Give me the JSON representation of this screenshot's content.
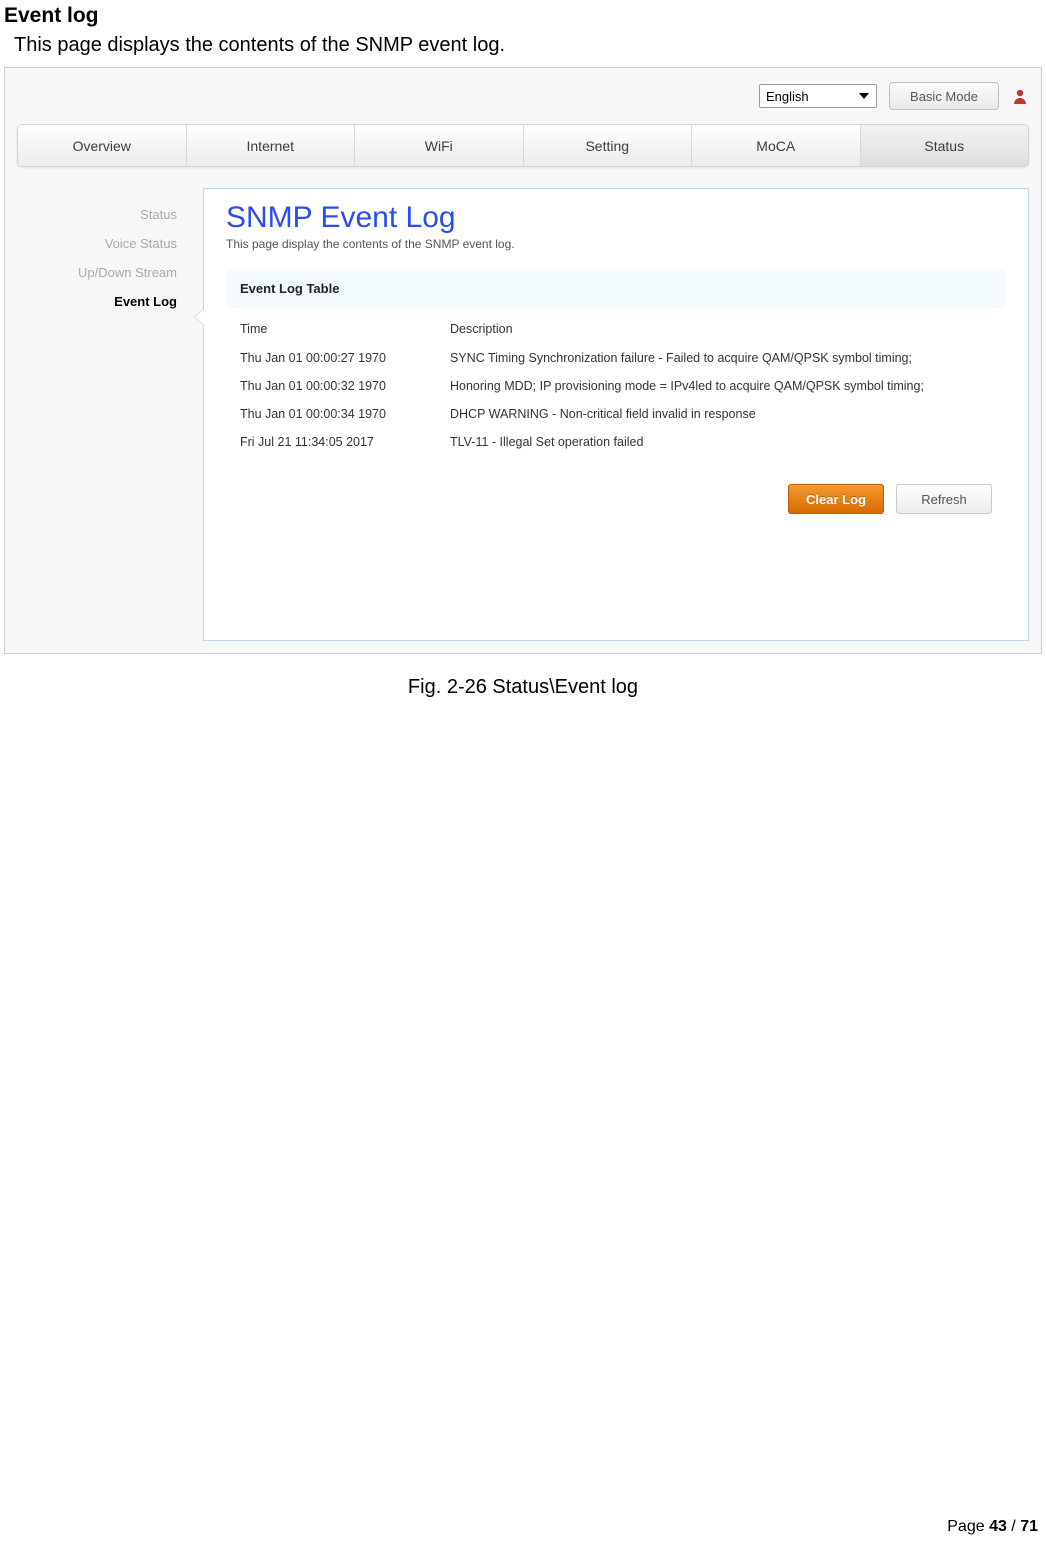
{
  "doc": {
    "heading": "Event log",
    "description": "This page displays the contents of the SNMP event log.",
    "caption": "Fig. 2-26 Status\\Event log",
    "footer_prefix": "Page ",
    "footer_page": "43",
    "footer_sep": " / ",
    "footer_total": "71"
  },
  "top": {
    "language_selected": "English",
    "basic_mode": "Basic Mode"
  },
  "tabs": {
    "items": [
      {
        "label": "Overview"
      },
      {
        "label": "Internet"
      },
      {
        "label": "WiFi"
      },
      {
        "label": "Setting"
      },
      {
        "label": "MoCA"
      },
      {
        "label": "Status"
      }
    ],
    "active_index": 5
  },
  "sidebar": {
    "items": [
      {
        "label": "Status"
      },
      {
        "label": "Voice Status"
      },
      {
        "label": "Up/Down Stream"
      },
      {
        "label": "Event Log"
      }
    ],
    "active_index": 3
  },
  "panel": {
    "title": "SNMP Event Log",
    "subtitle": "This page display the contents of the SNMP event log.",
    "table_header": "Event Log Table",
    "col_time": "Time",
    "col_desc": "Description",
    "rows": [
      {
        "time": "Thu Jan 01 00:00:27 1970",
        "desc": "SYNC Timing Synchronization failure - Failed to acquire QAM/QPSK symbol timing;"
      },
      {
        "time": "Thu Jan 01 00:00:32 1970",
        "desc": "Honoring MDD; IP provisioning mode = IPv4led to acquire QAM/QPSK symbol timing;"
      },
      {
        "time": "Thu Jan 01 00:00:34 1970",
        "desc": "DHCP WARNING - Non-critical field invalid in response"
      },
      {
        "time": "Fri Jul 21 11:34:05 2017",
        "desc": "TLV-11 - Illegal Set operation failed"
      }
    ],
    "btn_clear": "Clear Log",
    "btn_refresh": "Refresh"
  }
}
